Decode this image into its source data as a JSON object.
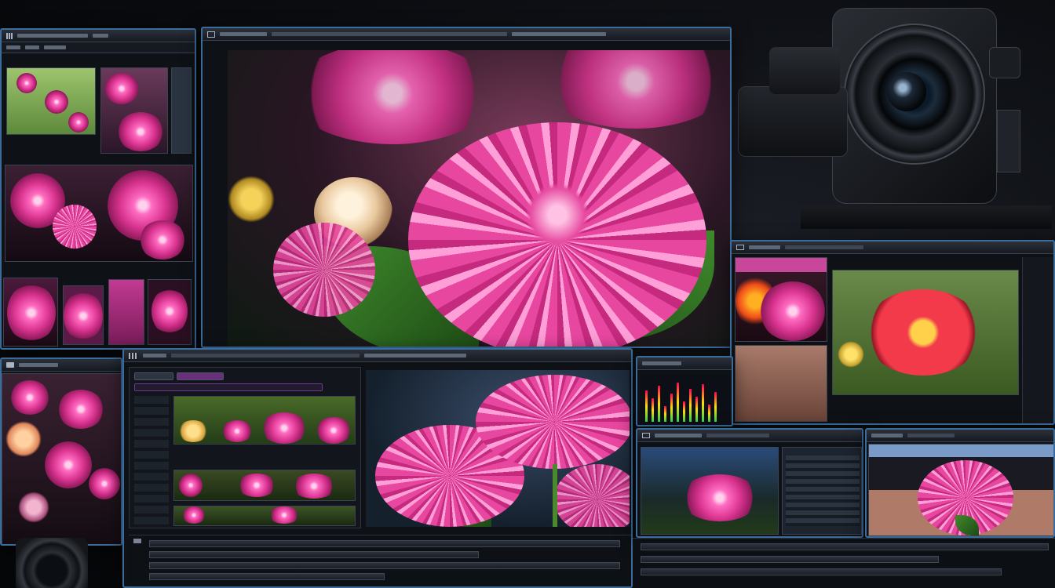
{
  "scene": {
    "description_free": true,
    "accent": "#3c6c9a",
    "flower_pink": "#e23c97",
    "flower_red": "#f23a4b",
    "leaf_green": "#3f8a2c"
  },
  "windows": {
    "library": {
      "icon": "grid-icon"
    },
    "viewer": {
      "icon": "image-icon"
    },
    "editor": {
      "icon": "film-icon"
    },
    "monitor": {
      "icon": "monitor-icon"
    },
    "bottom_left": {
      "icon": "folder-icon"
    },
    "bottom_right": {
      "icon": "preview-icon"
    }
  },
  "camera": {
    "icon": "camera-icon"
  },
  "timeline": {
    "icon": "timeline-icon",
    "tracks": 4
  }
}
